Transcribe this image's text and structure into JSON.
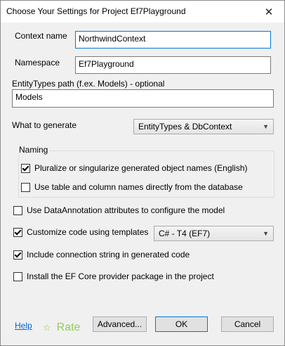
{
  "window": {
    "title": "Choose Your Settings for Project Ef7Playground",
    "close_glyph": "✕"
  },
  "fields": {
    "context_name": {
      "label": "Context name",
      "value": "NorthwindContext"
    },
    "namespace": {
      "label": "Namespace",
      "value": "Ef7Playground"
    },
    "entitytypes_path": {
      "label": "EntityTypes path (f.ex. Models) - optional",
      "value": "Models"
    },
    "what_to_generate": {
      "label": "What to generate",
      "selected": "EntityTypes & DbContext"
    }
  },
  "naming": {
    "title": "Naming",
    "pluralize": {
      "label": "Pluralize or singularize generated object names (English)",
      "checked": true
    },
    "use_db_names": {
      "label": "Use table and column names directly from the database",
      "checked": false
    }
  },
  "options": {
    "data_annotations": {
      "label": "Use DataAnnotation attributes to configure the model",
      "checked": false
    },
    "customize_templates": {
      "label": "Customize code using templates",
      "checked": true,
      "template_selected": "C# - T4 (EF7)"
    },
    "include_connection": {
      "label": "Include connection string in generated code",
      "checked": true
    },
    "install_provider": {
      "label": "Install the EF Core provider package in the project",
      "checked": false
    }
  },
  "footer": {
    "help": "Help",
    "rate": "Rate",
    "advanced": "Advanced...",
    "ok": "OK",
    "cancel": "Cancel"
  },
  "colors": {
    "accent": "#0078d7",
    "link": "#0066cc",
    "rate": "#8fd14f"
  },
  "icons": {
    "close": "close-icon",
    "dropdown": "chevron-down-icon",
    "rate": "star-icon",
    "check": "check-icon"
  }
}
